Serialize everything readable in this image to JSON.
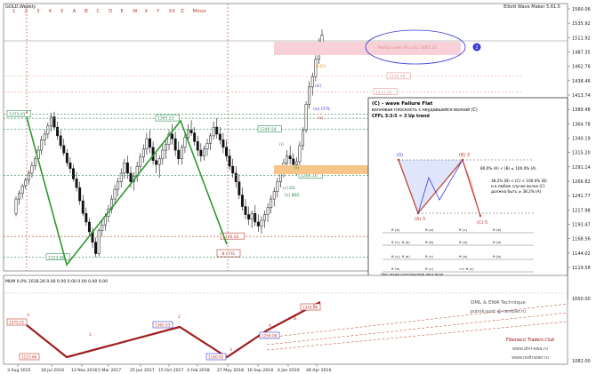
{
  "chart_data": {
    "type": "candlestick",
    "symbol": "GOLD,Weekly",
    "indicator_title": "Elliott Wave Maker 5.61.5",
    "top_labels": [
      "1",
      "2",
      "3",
      "4",
      "5",
      "A",
      "B",
      "C",
      "D",
      "E",
      "W",
      "X",
      "Y",
      "XX",
      "Z",
      "Minor"
    ],
    "price_ticks": [
      "1560.06",
      "1535.92",
      "1511.92",
      "1487.35",
      "1462.76",
      "1438.46",
      "1413.74",
      "1389.48",
      "1364.78",
      "1340.19",
      "1315.20",
      "1291.14",
      "1266.82",
      "1241.77",
      "1217.98",
      "1193.47",
      "1168.56",
      "1144.02",
      "1119.58"
    ],
    "date_ticks": [
      "3 Aug 2015",
      "18 Jul 2016",
      "13 Nov 2016",
      "5 Mar 2017",
      "25 Jun 2017",
      "15 Oct 2017",
      "4 Feb 2018",
      "27 May 2018",
      "16 Sep 2018",
      "6 Jan 2019",
      "28 Apr 2019"
    ],
    "ylim": [
      1100,
      1565
    ],
    "candles": [
      [
        1200,
        1230,
        1195,
        1225
      ],
      [
        1225,
        1240,
        1215,
        1235
      ],
      [
        1235,
        1252,
        1226,
        1248
      ],
      [
        1248,
        1262,
        1242,
        1258
      ],
      [
        1258,
        1275,
        1250,
        1270
      ],
      [
        1270,
        1290,
        1262,
        1283
      ],
      [
        1283,
        1300,
        1275,
        1295
      ],
      [
        1295,
        1318,
        1288,
        1310
      ],
      [
        1310,
        1335,
        1302,
        1328
      ],
      [
        1328,
        1345,
        1318,
        1338
      ],
      [
        1338,
        1358,
        1330,
        1352
      ],
      [
        1352,
        1375,
        1342,
        1368
      ],
      [
        1368,
        1377,
        1345,
        1350
      ],
      [
        1350,
        1360,
        1328,
        1335
      ],
      [
        1335,
        1345,
        1312,
        1318
      ],
      [
        1318,
        1330,
        1300,
        1305
      ],
      [
        1305,
        1312,
        1282,
        1288
      ],
      [
        1288,
        1298,
        1270,
        1278
      ],
      [
        1278,
        1285,
        1255,
        1260
      ],
      [
        1260,
        1272,
        1238,
        1245
      ],
      [
        1245,
        1255,
        1215,
        1222
      ],
      [
        1222,
        1232,
        1195,
        1200
      ],
      [
        1200,
        1210,
        1178,
        1185
      ],
      [
        1185,
        1192,
        1160,
        1168
      ],
      [
        1168,
        1175,
        1140,
        1150
      ],
      [
        1150,
        1158,
        1124,
        1130
      ],
      [
        1130,
        1175,
        1125,
        1170
      ],
      [
        1170,
        1188,
        1160,
        1180
      ],
      [
        1180,
        1200,
        1170,
        1195
      ],
      [
        1195,
        1215,
        1185,
        1208
      ],
      [
        1208,
        1232,
        1200,
        1225
      ],
      [
        1225,
        1250,
        1215,
        1242
      ],
      [
        1242,
        1262,
        1230,
        1255
      ],
      [
        1255,
        1278,
        1245,
        1270
      ],
      [
        1270,
        1295,
        1260,
        1288
      ],
      [
        1288,
        1300,
        1260,
        1270
      ],
      [
        1270,
        1282,
        1245,
        1255
      ],
      [
        1255,
        1272,
        1240,
        1265
      ],
      [
        1265,
        1290,
        1255,
        1282
      ],
      [
        1282,
        1305,
        1275,
        1298
      ],
      [
        1298,
        1320,
        1288,
        1312
      ],
      [
        1312,
        1340,
        1302,
        1330
      ],
      [
        1330,
        1345,
        1305,
        1315
      ],
      [
        1315,
        1325,
        1285,
        1292
      ],
      [
        1292,
        1305,
        1270,
        1285
      ],
      [
        1285,
        1300,
        1262,
        1295
      ],
      [
        1295,
        1320,
        1285,
        1310
      ],
      [
        1310,
        1330,
        1295,
        1320
      ],
      [
        1320,
        1345,
        1310,
        1338
      ],
      [
        1338,
        1355,
        1320,
        1330
      ],
      [
        1330,
        1342,
        1300,
        1310
      ],
      [
        1310,
        1325,
        1285,
        1295
      ],
      [
        1295,
        1320,
        1285,
        1315
      ],
      [
        1315,
        1340,
        1305,
        1332
      ],
      [
        1332,
        1355,
        1322,
        1345
      ],
      [
        1345,
        1362,
        1335,
        1340
      ],
      [
        1340,
        1350,
        1318,
        1325
      ],
      [
        1325,
        1335,
        1300,
        1310
      ],
      [
        1310,
        1322,
        1290,
        1300
      ],
      [
        1300,
        1318,
        1292,
        1312
      ],
      [
        1312,
        1330,
        1300,
        1322
      ],
      [
        1322,
        1340,
        1310,
        1335
      ],
      [
        1335,
        1360,
        1328,
        1350
      ],
      [
        1350,
        1366,
        1330,
        1338
      ],
      [
        1338,
        1350,
        1320,
        1328
      ],
      [
        1328,
        1340,
        1305,
        1315
      ],
      [
        1315,
        1328,
        1292,
        1300
      ],
      [
        1300,
        1312,
        1275,
        1282
      ],
      [
        1282,
        1295,
        1262,
        1270
      ],
      [
        1270,
        1282,
        1245,
        1255
      ],
      [
        1255,
        1268,
        1225,
        1232
      ],
      [
        1232,
        1245,
        1205,
        1212
      ],
      [
        1212,
        1225,
        1190,
        1198
      ],
      [
        1198,
        1212,
        1180,
        1190
      ],
      [
        1190,
        1205,
        1175,
        1200
      ],
      [
        1200,
        1215,
        1178,
        1185
      ],
      [
        1185,
        1198,
        1168,
        1178
      ],
      [
        1178,
        1195,
        1165,
        1188
      ],
      [
        1188,
        1205,
        1175,
        1198
      ],
      [
        1198,
        1218,
        1185,
        1210
      ],
      [
        1210,
        1232,
        1200,
        1225
      ],
      [
        1225,
        1245,
        1212,
        1238
      ],
      [
        1238,
        1262,
        1228,
        1255
      ],
      [
        1255,
        1280,
        1245,
        1272
      ],
      [
        1272,
        1295,
        1262,
        1288
      ],
      [
        1288,
        1310,
        1276,
        1300
      ],
      [
        1300,
        1318,
        1285,
        1295
      ],
      [
        1295,
        1305,
        1278,
        1285
      ],
      [
        1285,
        1298,
        1266,
        1290
      ],
      [
        1290,
        1325,
        1284,
        1318
      ],
      [
        1318,
        1350,
        1310,
        1345
      ],
      [
        1345,
        1395,
        1340,
        1390
      ],
      [
        1390,
        1430,
        1382,
        1420
      ],
      [
        1420,
        1445,
        1405,
        1438
      ],
      [
        1438,
        1475,
        1430,
        1468
      ],
      [
        1468,
        1505,
        1460,
        1498
      ],
      [
        1498,
        1520,
        1480,
        1510
      ]
    ],
    "levels": [
      {
        "label": "1373.01",
        "price": 1373,
        "color": "#2e8b57"
      },
      {
        "label": "1365.53",
        "price": 1365.5,
        "color": "#2e8b57"
      },
      {
        "label": "1346.54",
        "price": 1346.5,
        "color": "#2e8b57"
      },
      {
        "label": "1266.10",
        "price": 1266.1,
        "color": "#2e8b57"
      },
      {
        "label": "1160.02",
        "price": 1160,
        "color": "#c0392b"
      },
      {
        "label": "1123.66",
        "price": 1123.7,
        "color": "#2e8b57"
      },
      {
        "label": "1438.48",
        "price": 1438.5,
        "color": "#e39b9b"
      },
      {
        "label": "1411.05",
        "price": 1411,
        "color": "#e39b9b"
      }
    ],
    "labels": {
      "parity": "Parity Level (A)=(C) 1487.23",
      "circle_badge": "2",
      "cffl": "CFFL",
      "ed": "ED",
      "icffl": "(c) ED",
      "xx": "[x] BB2",
      "b_box": "B",
      "cffl_box": "CFFL",
      "wave_a": "A",
      "wave_b": "B",
      "wave_c": "C",
      "wave_i": "(i)",
      "wave_ii": "(ii)",
      "wave_iii": "(iii)",
      "wave_iv": "(iv)",
      "wave_v": "(v)",
      "wave_b_c": "b-(C)",
      "wave_a_r": "a"
    },
    "info_box": {
      "title": "(C) - wave Failure Flat",
      "subtitle": "волновая плоскость с неудавшейся волной (C)",
      "trend": "CFFL 3:3:5 = 3 Up trend",
      "top_left": "(0)",
      "top_mid": "(B) 3",
      "bot_a": "(A) 3",
      "bot_c": "(C) 5",
      "rule1": "80.0% (A) < (B) ≤ 100.0% (A)",
      "rule2a": "38.2% (B) < (C) < 100.0% (B)",
      "rule2b": "и в любом случае волна (C)",
      "rule2c": "должна быть ≥ 38.2% (A)",
      "fib_cells": [
        "ft (a)",
        "ft (a)",
        "ft (c)",
        "ft (b)",
        "ft (c)- ft (a)",
        "ft (b)",
        "ft (a)",
        "ft (b)",
        "ft (c)- ft (a)",
        "ft (c)",
        "ft (a)",
        "ft (b)",
        "ft (a)",
        "ft (c)",
        "<< ft (c)"
      ],
      "note1": "При таком соотношении двух волн,",
      "note2": "вершина волны (B) может касаться, но не может пересечь уровень основания волны (A),",
      "note3": "а вершина волны (C) не может пересечь уровень основания волны (B).",
      "author": "Created by Putnik"
    },
    "sub_panel": {
      "title": "MUM 0.0% 1018.26 0.00 0.00 0.00 0.00 0.00 0.00",
      "values": [
        "1375.01",
        "1365.53",
        "1123.66",
        "1160.02",
        "1343.90",
        "1256.08"
      ],
      "scale": [
        "1650.00",
        "1082.00"
      ],
      "labels": [
        "3",
        "1",
        "2",
        "3",
        "A",
        "B",
        "C"
      ]
    },
    "watermark": {
      "line1": "DML & EWA Technique",
      "line2": "putnik-post @ rambler.ru",
      "line3": "Fibonacci Traders Club",
      "line4": "www.dml-ewa.ru",
      "line5": "www.redtrader.ru"
    }
  }
}
